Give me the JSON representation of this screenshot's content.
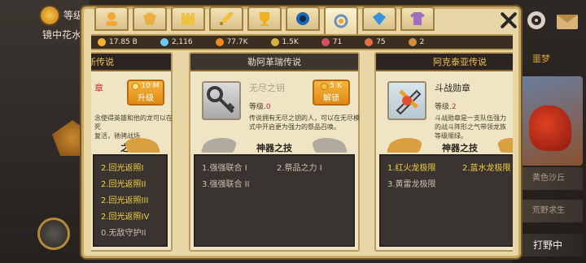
{
  "background": {
    "level_label": "等级",
    "location": "镜中花水",
    "dream_label": "噩梦",
    "list": [
      {
        "label": "黄色沙丘"
      },
      {
        "label": "荒野求生"
      }
    ],
    "wild_button": "打野中"
  },
  "tabs": [
    {
      "icon": "hero-icon"
    },
    {
      "icon": "crest-icon"
    },
    {
      "icon": "castle-icon"
    },
    {
      "icon": "sword-icon"
    },
    {
      "icon": "trophy-icon"
    },
    {
      "icon": "orb-icon"
    },
    {
      "icon": "relic-icon",
      "active": true
    },
    {
      "icon": "gem-icon"
    },
    {
      "icon": "shirt-icon"
    }
  ],
  "resources": [
    {
      "icon": "gold-coin-icon",
      "value": "17.85 B",
      "color": "#f2b030"
    },
    {
      "icon": "diamond-icon",
      "value": "2,116",
      "color": "#6ac8f4"
    },
    {
      "icon": "orange-coin-icon",
      "value": "77.7K",
      "color": "#f08a20"
    },
    {
      "icon": "star-badge-icon",
      "value": "1.5K",
      "color": "#d8b040"
    },
    {
      "icon": "rune-icon",
      "value": "71",
      "color": "#d85060"
    },
    {
      "icon": "spark-icon",
      "value": "75",
      "color": "#e07040"
    },
    {
      "icon": "medal-icon",
      "value": "2",
      "color": "#d09040"
    }
  ],
  "columns": {
    "left": {
      "title": "新传说",
      "item_name": "章",
      "upgrade_cost": "10 M",
      "upgrade_label": "升级",
      "desc": "念使得英雄和他的龙可以在死\n复活，驰骋战场",
      "skill_title": "之技",
      "skills": [
        {
          "label": "2.回光返照I",
          "on": true
        },
        {
          "label": "2.回光返照II",
          "on": true
        },
        {
          "label": "2.回光返照III",
          "on": true
        },
        {
          "label": "2.回光返照IV",
          "on": true
        },
        {
          "label": "0.无敌守护II",
          "on": false
        }
      ]
    },
    "mid": {
      "title": "勒阿革瑞传说",
      "item_name": "无尽之钥",
      "level_label": "等级.",
      "level_value": "0",
      "unlock_cost": "5 K",
      "unlock_label": "解锁",
      "desc": "传说拥有无尽之钥的人，可以在无尽模\n式中开启更为强力的祭品召唤。",
      "skill_title": "神器之技",
      "skills_left": [
        {
          "label": "1.强强联合 I"
        },
        {
          "label": "3.强强联合 II"
        }
      ],
      "skills_right": [
        {
          "label": "2.祭品之力 I"
        }
      ]
    },
    "right": {
      "title": "阿克泰亚传说",
      "item_name": "斗战勋章",
      "level_label": "等级.",
      "level_value": "2",
      "desc": "斗战勋章是一支队伍强力\n的战斗阵形之气带领龙族\n等级顺绿。",
      "skill_title": "神器之技",
      "skills_left": [
        {
          "label": "1.红火龙极限",
          "on": true
        },
        {
          "label": "3.黄雷龙极限",
          "on": false
        }
      ],
      "skills_right": [
        {
          "label": "2.蓝水龙极限",
          "on": true
        }
      ]
    }
  }
}
